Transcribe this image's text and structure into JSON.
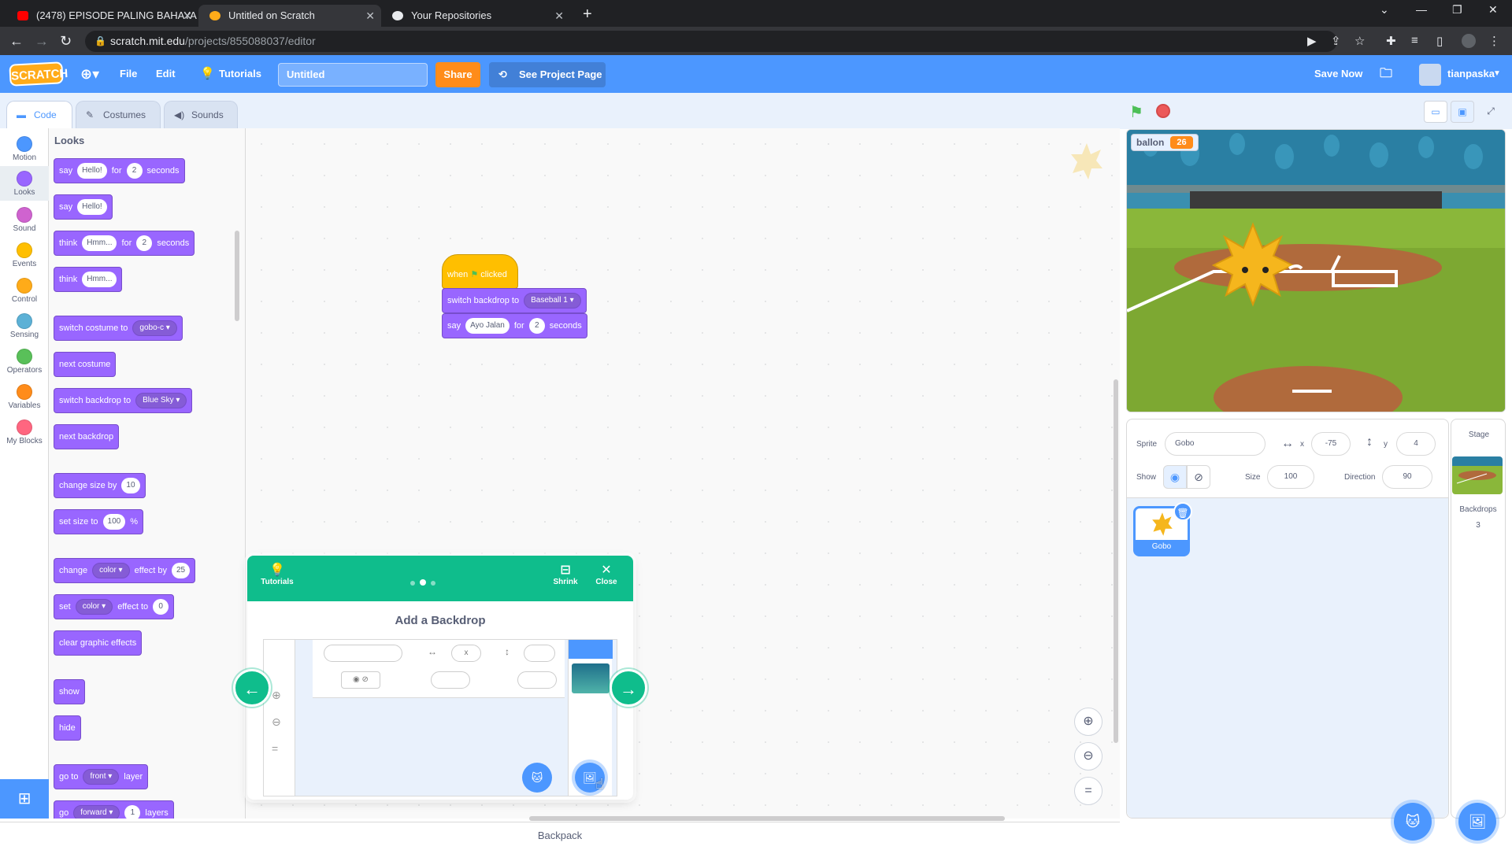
{
  "browser": {
    "tabs": [
      {
        "title": "(2478) EPISODE PALING BAHAYA",
        "active": false
      },
      {
        "title": "Untitled on Scratch",
        "active": true
      },
      {
        "title": "Your Repositories",
        "active": false
      }
    ],
    "url_host": "scratch.mit.edu",
    "url_path": "/projects/855088037/editor"
  },
  "menubar": {
    "logo": "SCRATCH",
    "file": "File",
    "edit": "Edit",
    "tutorials": "Tutorials",
    "project_title": "Untitled",
    "share": "Share",
    "see_project": "See Project Page",
    "save_now": "Save Now",
    "username": "tianpaska"
  },
  "editor_tabs": {
    "code": "Code",
    "costumes": "Costumes",
    "sounds": "Sounds"
  },
  "categories": [
    {
      "label": "Motion",
      "color": "#4c97ff"
    },
    {
      "label": "Looks",
      "color": "#9966ff"
    },
    {
      "label": "Sound",
      "color": "#cf63cf"
    },
    {
      "label": "Events",
      "color": "#ffbf00"
    },
    {
      "label": "Control",
      "color": "#ffab19"
    },
    {
      "label": "Sensing",
      "color": "#5cb1d6"
    },
    {
      "label": "Operators",
      "color": "#59c059"
    },
    {
      "label": "Variables",
      "color": "#ff8c1a"
    },
    {
      "label": "My Blocks",
      "color": "#ff6680"
    }
  ],
  "palette": {
    "title": "Looks",
    "b1": {
      "a": "say",
      "v1": "Hello!",
      "b": "for",
      "v2": "2",
      "c": "seconds"
    },
    "b2": {
      "a": "say",
      "v1": "Hello!"
    },
    "b3": {
      "a": "think",
      "v1": "Hmm...",
      "b": "for",
      "v2": "2",
      "c": "seconds"
    },
    "b4": {
      "a": "think",
      "v1": "Hmm..."
    },
    "b5": {
      "a": "switch costume to",
      "v1": "gobo-c"
    },
    "b6": {
      "a": "next costume"
    },
    "b7": {
      "a": "switch backdrop to",
      "v1": "Blue Sky"
    },
    "b8": {
      "a": "next backdrop"
    },
    "b9": {
      "a": "change size by",
      "v1": "10"
    },
    "b10": {
      "a": "set size to",
      "v1": "100",
      "b": "%"
    },
    "b11": {
      "a": "change",
      "v1": "color",
      "b": "effect by",
      "v2": "25"
    },
    "b12": {
      "a": "set",
      "v1": "color",
      "b": "effect to",
      "v2": "0"
    },
    "b13": {
      "a": "clear graphic effects"
    },
    "b14": {
      "a": "show"
    },
    "b15": {
      "a": "hide"
    },
    "b16": {
      "a": "go to",
      "v1": "front",
      "b": "layer"
    },
    "b17": {
      "a": "go",
      "v1": "forward",
      "v2": "1",
      "b": "layers"
    }
  },
  "script": {
    "hat": {
      "a": "when",
      "b": "clicked"
    },
    "s1": {
      "a": "switch backdrop to",
      "v1": "Baseball 1"
    },
    "s2": {
      "a": "say",
      "v1": "Ayo Jalan",
      "b": "for",
      "v2": "2",
      "c": "seconds"
    }
  },
  "backpack": "Backpack",
  "stage": {
    "variable_name": "ballon",
    "variable_value": "26"
  },
  "sprite_info": {
    "sprite_label": "Sprite",
    "sprite_name": "Gobo",
    "x_label": "x",
    "x_value": "-75",
    "y_label": "y",
    "y_value": "4",
    "show_label": "Show",
    "size_label": "Size",
    "size_value": "100",
    "direction_label": "Direction",
    "direction_value": "90"
  },
  "sprites": [
    {
      "name": "Gobo"
    }
  ],
  "stage_panel": {
    "title": "Stage",
    "backdrops_label": "Backdrops",
    "backdrops_count": "3"
  },
  "tutorial": {
    "tutorials_label": "Tutorials",
    "shrink_label": "Shrink",
    "close_label": "Close",
    "title": "Add a Backdrop",
    "mini_x_label": "x"
  },
  "colors": {
    "scratch_blue": "#4c97ff",
    "looks_purple": "#9966ff",
    "events_yellow": "#ffbf00",
    "tutorial_green": "#0fbd8c",
    "share_orange": "#ff8c1a"
  }
}
